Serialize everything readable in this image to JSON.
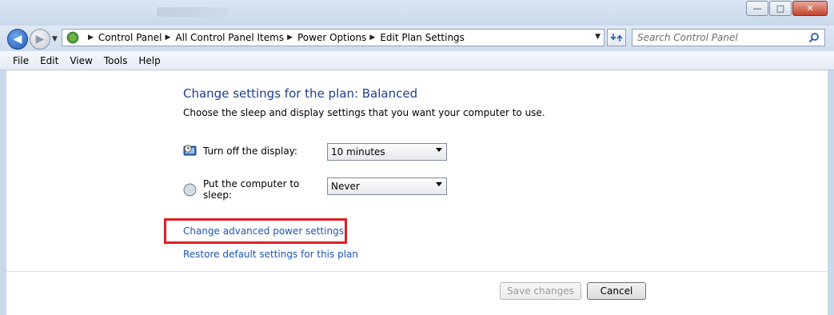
{
  "window": {
    "controls": {
      "minimize": "—",
      "maximize": "□",
      "close": "✕"
    }
  },
  "navigation": {
    "back": "◀",
    "forward": "▶",
    "breadcrumb": [
      "Control Panel",
      "All Control Panel Items",
      "Power Options",
      "Edit Plan Settings"
    ],
    "search_placeholder": "Search Control Panel"
  },
  "menu": [
    "File",
    "Edit",
    "View",
    "Tools",
    "Help"
  ],
  "plan": {
    "title": "Change settings for the plan: Balanced",
    "description": "Choose the sleep and display settings that you want your computer to use.",
    "settings": [
      {
        "label": "Turn off the display:",
        "value": "10 minutes",
        "icon": "display-clock-icon"
      },
      {
        "label": "Put the computer to sleep:",
        "value": "Never",
        "icon": "sleep-moon-icon"
      }
    ],
    "links": {
      "advanced": "Change advanced power settings",
      "restore": "Restore default settings for this plan"
    }
  },
  "buttons": {
    "save": "Save changes",
    "cancel": "Cancel"
  },
  "colors": {
    "title_blue": "#1e3f8e",
    "link_blue": "#1b55b8",
    "highlight_red": "#e01e26"
  }
}
